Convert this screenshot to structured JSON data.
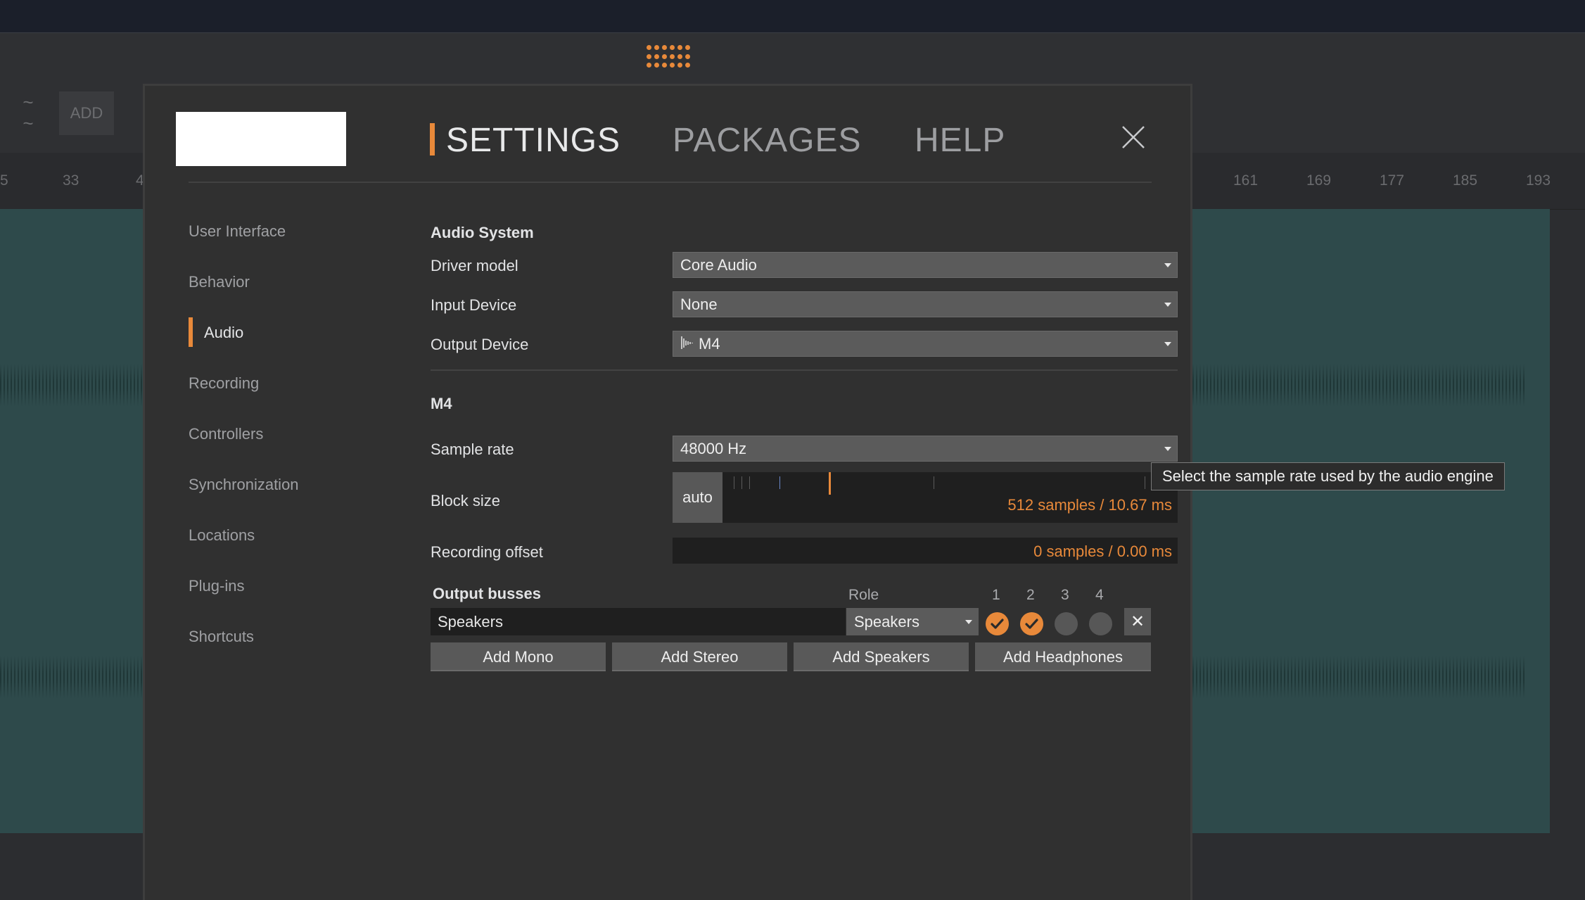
{
  "background": {
    "add_label": "ADD",
    "ruler_ticks": [
      "5",
      "33",
      "4",
      "161",
      "169",
      "177",
      "185",
      "193"
    ]
  },
  "modal": {
    "tabs": [
      {
        "label": "SETTINGS",
        "active": true
      },
      {
        "label": "PACKAGES",
        "active": false
      },
      {
        "label": "HELP",
        "active": false
      }
    ],
    "accent_color": "#e8893a"
  },
  "sidebar": {
    "items": [
      {
        "label": "User Interface",
        "active": false
      },
      {
        "label": "Behavior",
        "active": false
      },
      {
        "label": "Audio",
        "active": true
      },
      {
        "label": "Recording",
        "active": false
      },
      {
        "label": "Controllers",
        "active": false
      },
      {
        "label": "Synchronization",
        "active": false
      },
      {
        "label": "Locations",
        "active": false
      },
      {
        "label": "Plug-ins",
        "active": false
      },
      {
        "label": "Shortcuts",
        "active": false
      }
    ]
  },
  "audio_system": {
    "heading": "Audio System",
    "driver_model": {
      "label": "Driver model",
      "value": "Core Audio"
    },
    "input_device": {
      "label": "Input Device",
      "value": "None"
    },
    "output_device": {
      "label": "Output Device",
      "value": "M4"
    }
  },
  "device": {
    "heading": "M4",
    "sample_rate": {
      "label": "Sample rate",
      "value": "48000 Hz"
    },
    "block_size": {
      "label": "Block size",
      "auto_label": "auto",
      "value": "512 samples / 10.67 ms"
    },
    "recording_offset": {
      "label": "Recording offset",
      "value": "0 samples / 0.00 ms"
    }
  },
  "output_busses": {
    "heading": "Output busses",
    "role_header": "Role",
    "channel_headers": [
      "1",
      "2",
      "3",
      "4"
    ],
    "rows": [
      {
        "name": "Speakers",
        "role": "Speakers",
        "channels": [
          true,
          true,
          false,
          false
        ],
        "remove_label": "✕"
      }
    ],
    "buttons": [
      "Add Mono",
      "Add Stereo",
      "Add Speakers",
      "Add Headphones"
    ]
  },
  "tooltip": {
    "text": "Select the sample rate used by the audio engine"
  }
}
